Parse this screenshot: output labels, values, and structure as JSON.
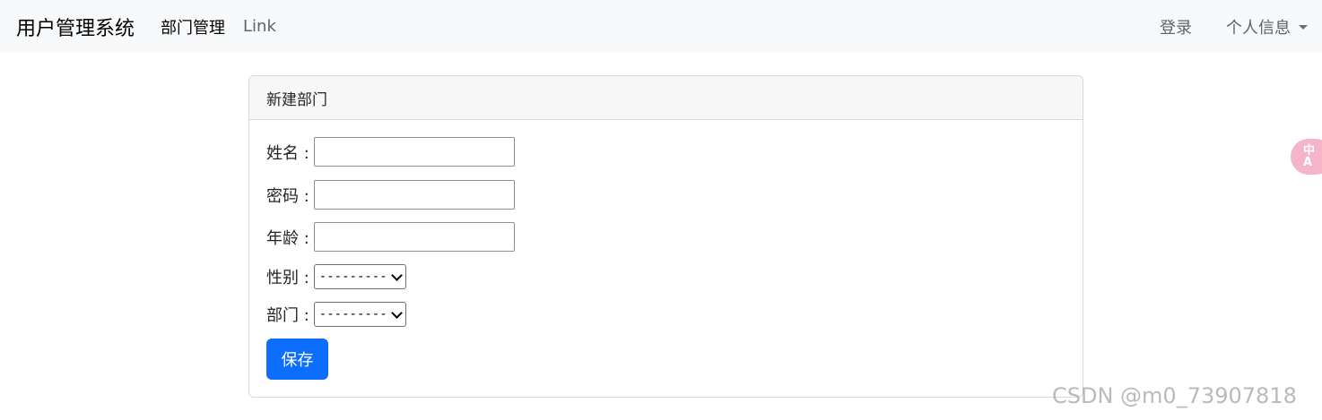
{
  "navbar": {
    "brand": "用户管理系统",
    "links": [
      {
        "label": "部门管理"
      },
      {
        "label": "Link"
      }
    ],
    "login": "登录",
    "profile": "个人信息"
  },
  "card": {
    "title": "新建部门",
    "fields": [
      {
        "label": "姓名 :",
        "value": ""
      },
      {
        "label": "密码 :",
        "value": ""
      },
      {
        "label": "年龄 :",
        "value": ""
      }
    ],
    "gender": {
      "label": "性别 :",
      "selected": "---------"
    },
    "department": {
      "label": "部门 :",
      "selected": "---------"
    },
    "save_label": "保存"
  },
  "floating": {
    "text_top": "中",
    "text_bottom": "A"
  },
  "watermark": "CSDN @m0_73907818"
}
